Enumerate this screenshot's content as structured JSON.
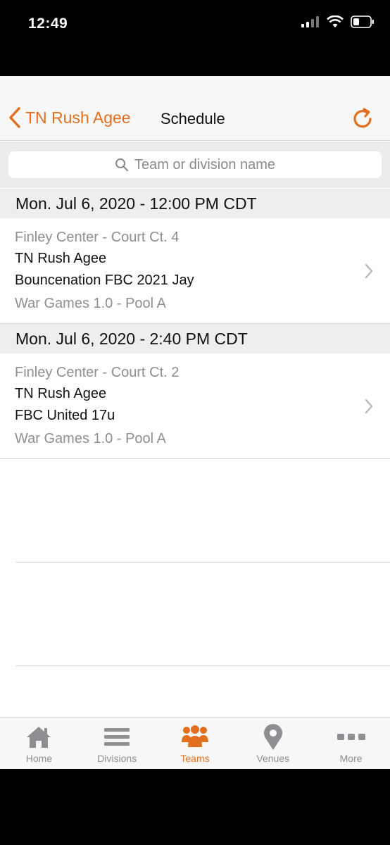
{
  "status": {
    "time": "12:49"
  },
  "nav": {
    "back_label": "TN Rush Agee",
    "title": "Schedule"
  },
  "search": {
    "placeholder": "Team or division name"
  },
  "sections": [
    {
      "header": "Mon. Jul 6, 2020 - 12:00 PM CDT",
      "game": {
        "venue": "Finley Center - Court Ct. 4",
        "team1": "TN Rush Agee",
        "team2": "Bouncenation FBC 2021 Jay",
        "pool": "War Games 1.0 - Pool A"
      }
    },
    {
      "header": "Mon. Jul 6, 2020 - 2:40 PM CDT",
      "game": {
        "venue": "Finley Center - Court Ct. 2",
        "team1": "TN Rush Agee",
        "team2": "FBC United 17u",
        "pool": "War Games 1.0 - Pool A"
      }
    }
  ],
  "tabs": [
    {
      "label": "Home",
      "icon": "home-icon"
    },
    {
      "label": "Divisions",
      "icon": "list-icon"
    },
    {
      "label": "Teams",
      "icon": "teams-icon",
      "active": true
    },
    {
      "label": "Venues",
      "icon": "map-pin-icon"
    },
    {
      "label": "More",
      "icon": "more-dots-icon"
    }
  ],
  "colors": {
    "accent": "#e07020",
    "inactive": "#8e8e93"
  }
}
